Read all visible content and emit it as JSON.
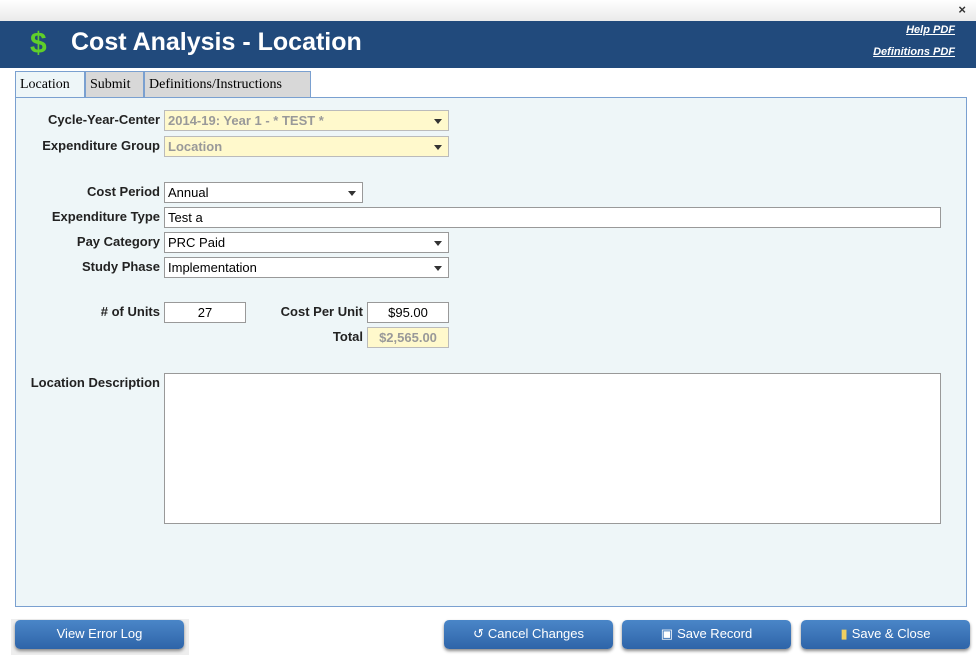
{
  "window": {
    "close": "×"
  },
  "header": {
    "icon": "$",
    "title": "Cost Analysis - Location",
    "help_link": "Help PDF",
    "definitions_link": "Definitions PDF"
  },
  "tabs": [
    {
      "label": "Location"
    },
    {
      "label": "Submit"
    },
    {
      "label": "Definitions/Instructions"
    }
  ],
  "form": {
    "cycle_label": "Cycle-Year-Center",
    "cycle_value": "2014-19: Year 1 - * TEST *",
    "group_label": "Expenditure Group",
    "group_value": "Location",
    "period_label": "Cost Period",
    "period_value": "Annual",
    "type_label": "Expenditure Type",
    "type_value": "Test a",
    "pay_label": "Pay Category",
    "pay_value": "PRC Paid",
    "phase_label": "Study Phase",
    "phase_value": "Implementation",
    "units_label": "# of Units",
    "units_value": "27",
    "cpu_label": "Cost Per Unit",
    "cpu_value": "$95.00",
    "total_label": "Total",
    "total_value": "$2,565.00",
    "desc_label": "Location Description",
    "desc_value": ""
  },
  "buttons": {
    "error_log": "View Error Log",
    "cancel": "Cancel Changes",
    "save": "Save Record",
    "save_close": "Save & Close"
  }
}
